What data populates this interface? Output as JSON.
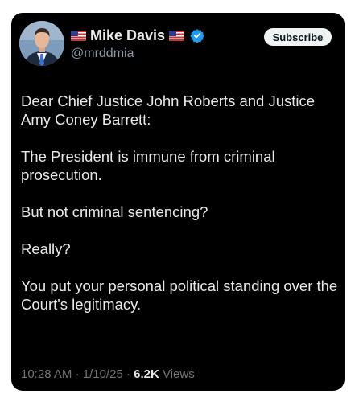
{
  "author": {
    "name": "Mike Davis",
    "handle": "@mrddmia",
    "name_prefix_icon": "us-flag-icon",
    "name_suffix_icon": "us-flag-icon",
    "badge_icon": "verified-badge-icon",
    "badge_color": "#1d9bf0"
  },
  "actions": {
    "subscribe_label": "Subscribe"
  },
  "tweet": {
    "paragraphs": [
      "Dear Chief Justice John Roberts and Justice Amy Coney Barrett:",
      "The President is immune from criminal prosecution.",
      "But not criminal sentencing?",
      "Really?",
      "You put your personal political standing over the Court's legitimacy."
    ]
  },
  "meta": {
    "time": "10:28 AM",
    "separator": "·",
    "date": "1/10/25",
    "views_count": "6.2K",
    "views_label": "Views"
  },
  "colors": {
    "background": "#000000",
    "text": "#e7e9ea",
    "secondary_text": "#71767b",
    "accent": "#1d9bf0"
  }
}
